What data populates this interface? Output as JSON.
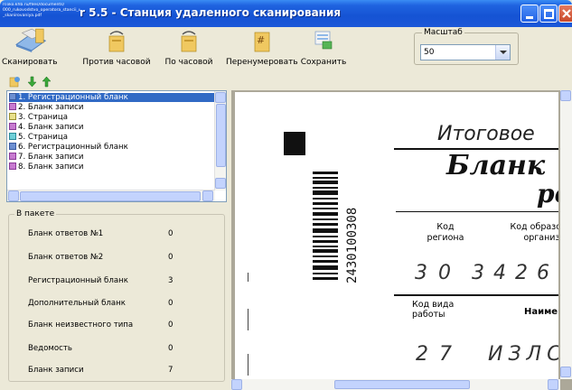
{
  "window": {
    "url_lines": [
      "rcoko.khb.ru/files/documents/",
      "000_rukovodstvo_operatora_stancii_udalennogo",
      "_skanirovaniya.pdf"
    ],
    "title": "r 5.5 - Станция удаленного сканирования"
  },
  "toolbar": {
    "scan_label": "Сканировать",
    "ccw_label": "Против часовой",
    "cw_label": "По часовой",
    "renumber_label": "Перенумеровать",
    "save_label": "Сохранить",
    "zoom_legend": "Масштаб",
    "zoom_value": "50"
  },
  "list": {
    "items": [
      {
        "label": "1. Регистрационный бланк",
        "color": "#6d8fd1"
      },
      {
        "label": "2. Бланк записи",
        "color": "#c77ad0"
      },
      {
        "label": "3. Страница",
        "color": "#e8e08a"
      },
      {
        "label": "4. Бланк записи",
        "color": "#c77ad0"
      },
      {
        "label": "5. Страница",
        "color": "#6fd0d8"
      },
      {
        "label": "6. Регистрационный бланк",
        "color": "#6d8fd1"
      },
      {
        "label": "7. Бланк записи",
        "color": "#c77ad0"
      },
      {
        "label": "8. Бланк записи",
        "color": "#c77ad0"
      }
    ]
  },
  "packet": {
    "legend": "В пакете",
    "rows": [
      {
        "label": "Бланк ответов №1",
        "value": "0"
      },
      {
        "label": "Бланк ответов №2",
        "value": "0"
      },
      {
        "label": "Регистрационный бланк",
        "value": "3"
      },
      {
        "label": "Дополнительный бланк",
        "value": "0"
      },
      {
        "label": "Бланк неизвестного типа",
        "value": "0"
      },
      {
        "label": "Ведомость",
        "value": "0"
      },
      {
        "label": "Бланк записи",
        "value": "7"
      }
    ]
  },
  "document": {
    "heading1": "Итоговое",
    "heading2": "Бланк",
    "heading3": "ре",
    "barcode_number": "2430100308",
    "region_label": "Код\nрегиона",
    "org_label": "Код образоват\nорганизаци",
    "region_value": "30",
    "org_value": "3426",
    "work_type_label": "Код вида\nработы",
    "name_label": "Наимен",
    "work_type_value": "27",
    "name_value": "ИЗЛС"
  }
}
